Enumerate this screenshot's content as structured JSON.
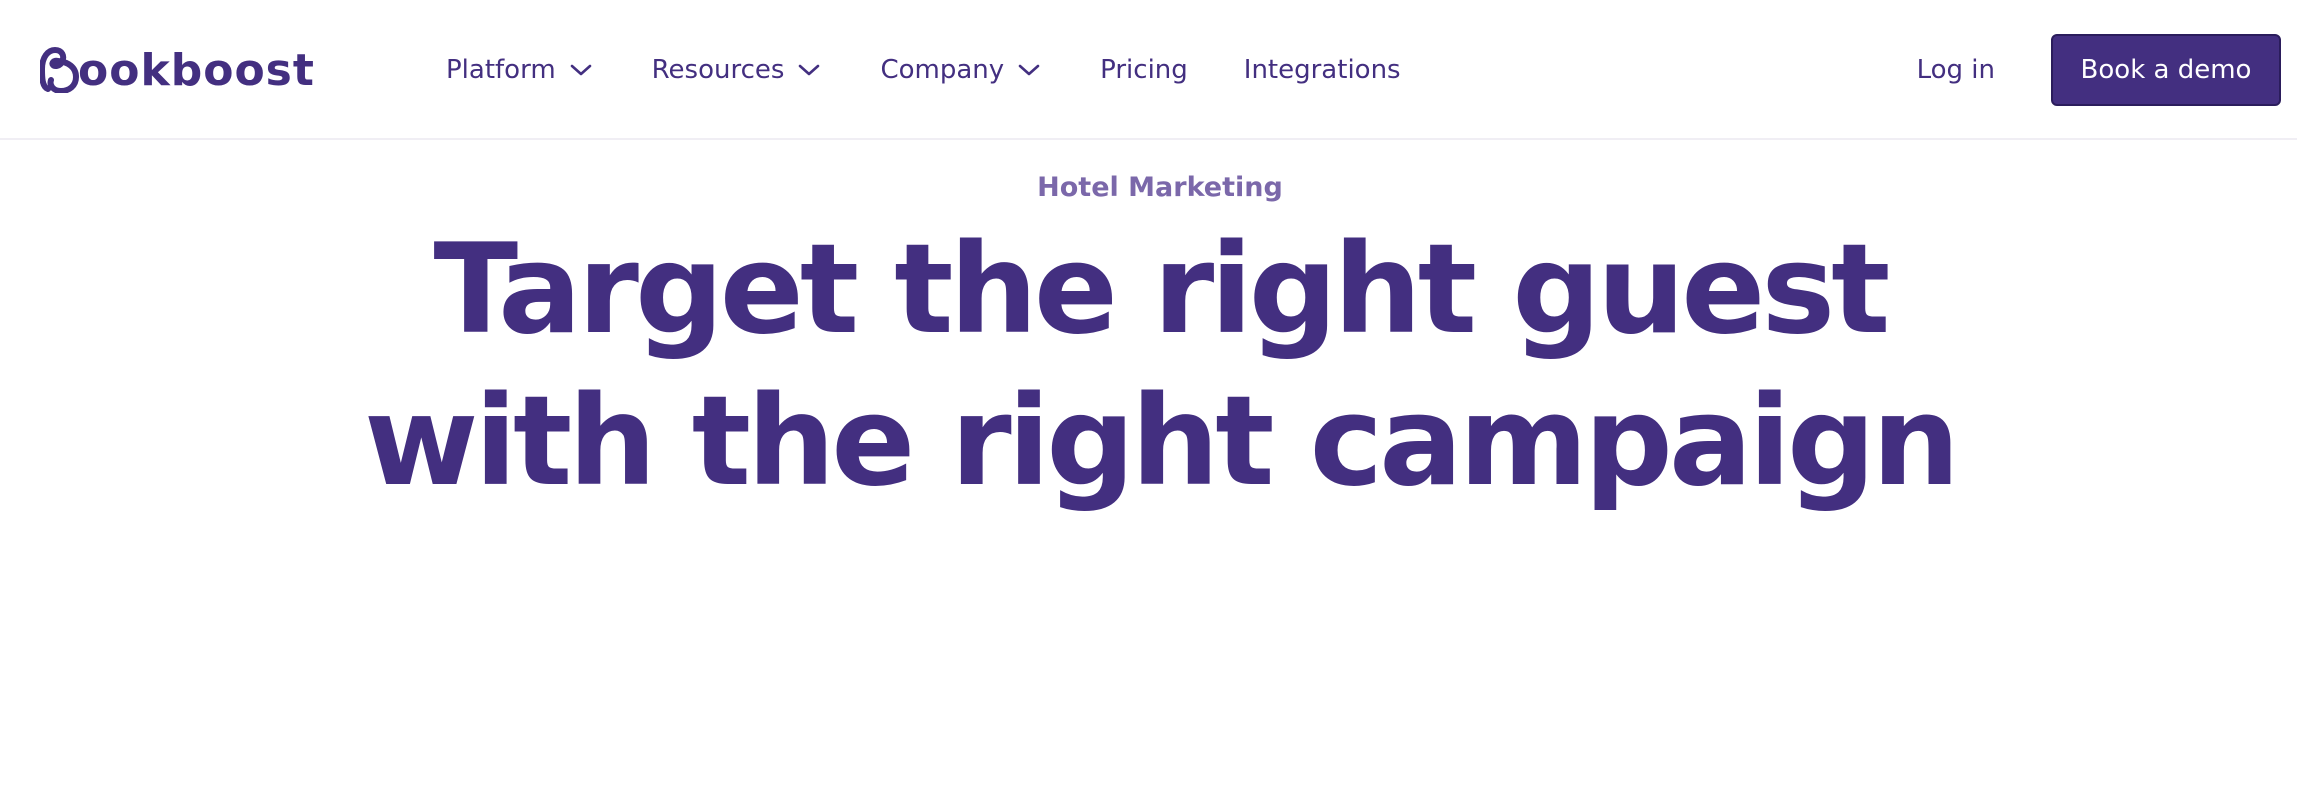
{
  "brand": {
    "name": "Bookboost",
    "logo_text": "ookboost",
    "color": "#432f80"
  },
  "nav": {
    "items": [
      {
        "label": "Platform",
        "has_dropdown": true,
        "icon": "chevron-down-icon"
      },
      {
        "label": "Resources",
        "has_dropdown": true,
        "icon": "chevron-down-icon"
      },
      {
        "label": "Company",
        "has_dropdown": true,
        "icon": "chevron-down-icon"
      },
      {
        "label": "Pricing",
        "has_dropdown": false
      },
      {
        "label": "Integrations",
        "has_dropdown": false
      }
    ],
    "login_label": "Log in",
    "cta_label": "Book a demo"
  },
  "hero": {
    "eyebrow": "Hotel Marketing",
    "headline_line1": "Target the right guest",
    "headline_line2": "with the right campaign"
  },
  "colors": {
    "primary": "#432f80",
    "eyebrow": "#7b68aa",
    "background": "#ffffff"
  }
}
